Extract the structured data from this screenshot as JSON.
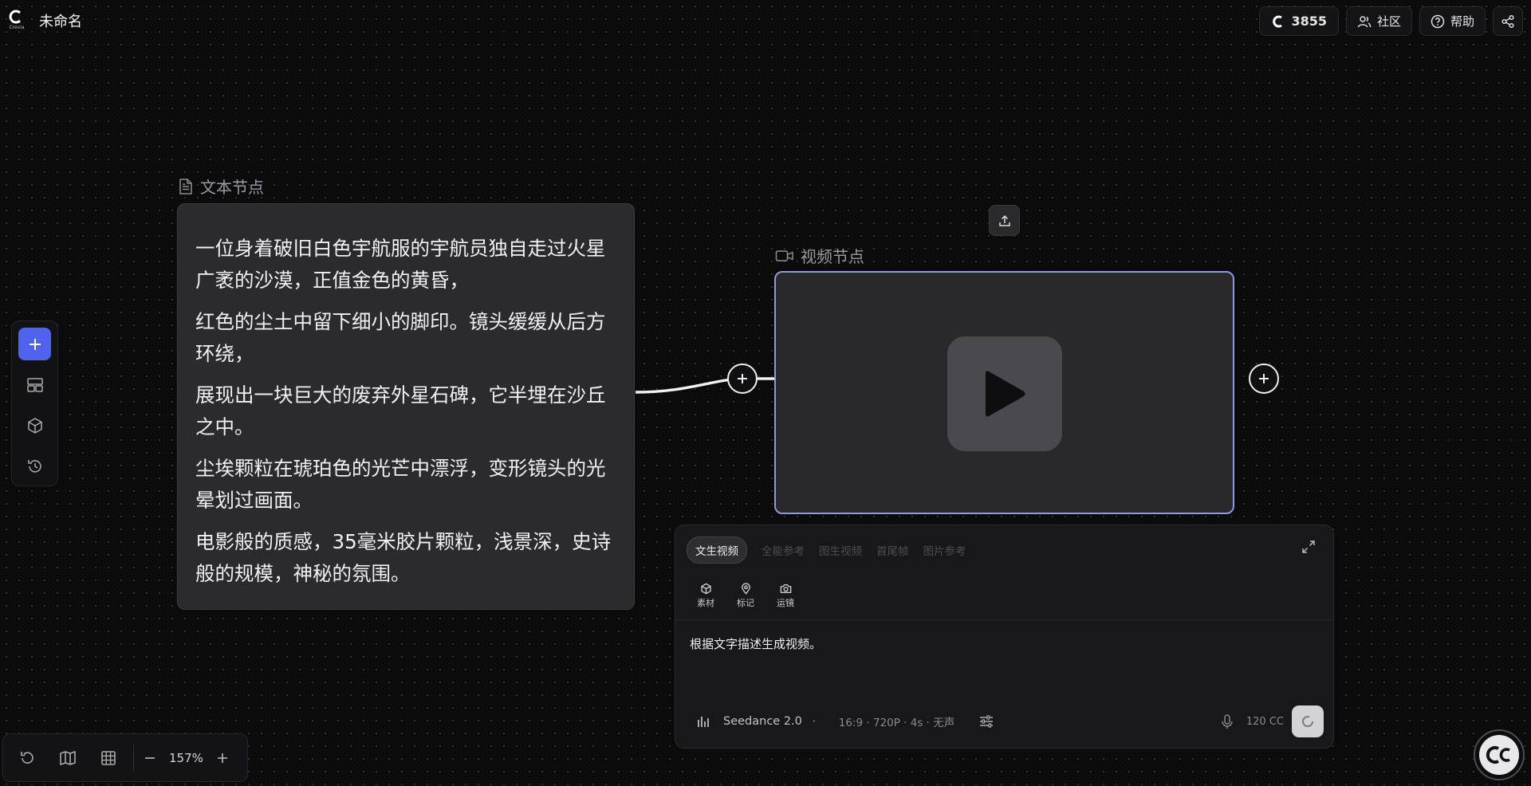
{
  "app": {
    "logo_text": "Crevia",
    "title": "未命名"
  },
  "topbar": {
    "credits": "3855",
    "community_label": "社区",
    "help_label": "帮助"
  },
  "left_toolbar": {
    "items": [
      "add",
      "layout",
      "assets",
      "history"
    ]
  },
  "text_node": {
    "label": "文本节点",
    "paragraphs": [
      "一位身着破旧白色宇航服的宇航员独自走过火星广袤的沙漠，正值金色的黄昏，",
      "红色的尘土中留下细小的脚印。镜头缓缓从后方环绕，",
      "展现出一块巨大的废弃外星石碑，它半埋在沙丘之中。",
      "尘埃颗粒在琥珀色的光芒中漂浮，变形镜头的光晕划过画面。",
      "电影般的质感，35毫米胶片颗粒，浅景深，史诗般的规模，神秘的氛围。"
    ]
  },
  "video_node": {
    "label": "视频节点"
  },
  "panel": {
    "tabs": [
      "文生视频",
      "全能参考",
      "图生视频",
      "首尾帧",
      "图片参考"
    ],
    "active_tab": "文生视频",
    "subtools": [
      "素材",
      "标记",
      "运镜"
    ],
    "prompt": "根据文字描述生成视频。",
    "model": "Seedance 2.0",
    "params": "16:9 · 720P · 4s · 无声",
    "cost": "120 CC"
  },
  "zoom": {
    "value": "157%"
  },
  "colors": {
    "accent": "#4f63ef",
    "node_selected_border": "#8d9adf",
    "background": "#0b0b0c"
  }
}
